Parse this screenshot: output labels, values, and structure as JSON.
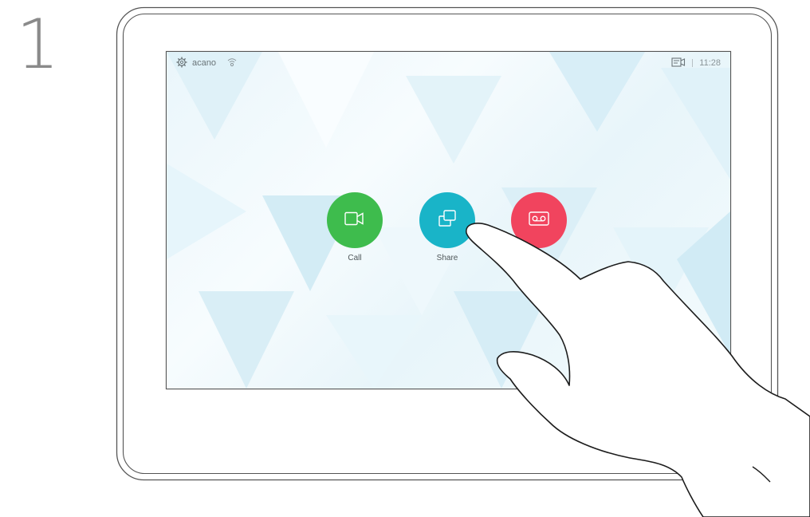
{
  "step": {
    "number": "1"
  },
  "status_bar": {
    "settings_icon": "gear-icon",
    "device_name": "acano",
    "signal_icon": "wireless-icon",
    "selfview_icon": "selfview-icon",
    "time": "11:28"
  },
  "actions": [
    {
      "label": "Call",
      "icon": "video-camera-icon",
      "color": "#3ebc4d"
    },
    {
      "label": "Share",
      "icon": "share-screens-icon",
      "color": "#19b4c8"
    },
    {
      "label": "",
      "icon": "voicemail-icon",
      "color": "#f1445e"
    }
  ],
  "colors": {
    "step_number": "#8a8a8a",
    "device_outline": "#555555",
    "screen_background": "#eef8fc"
  }
}
